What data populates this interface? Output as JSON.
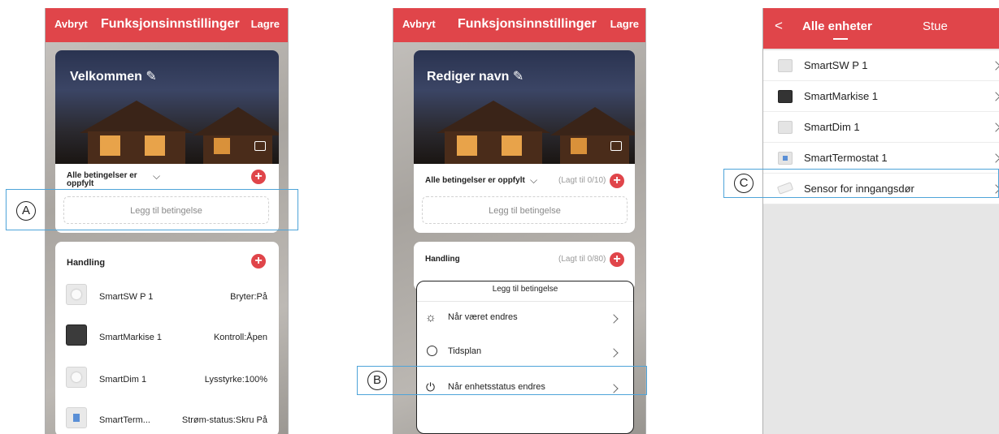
{
  "panel1": {
    "header": {
      "cancel": "Avbryt",
      "title": "Funksjonsinnstillinger",
      "save": "Lagre"
    },
    "scene_name": "Velkommen",
    "conditions": {
      "label": "Alle betingelser er oppfylt",
      "add_condition": "Legg til betingelse"
    },
    "action": {
      "title": "Handling",
      "items": [
        {
          "name": "SmartSW P 1",
          "status": "Bryter:På"
        },
        {
          "name": "SmartMarkise 1",
          "status": "Kontroll:Åpen"
        },
        {
          "name": "SmartDim 1",
          "status": "Lysstyrke:100%"
        },
        {
          "name": "SmartTerm...",
          "status": "Strøm-status:Skru På"
        }
      ]
    }
  },
  "panel2": {
    "header": {
      "cancel": "Avbryt",
      "title": "Funksjonsinnstillinger",
      "save": "Lagre"
    },
    "scene_name": "Rediger navn",
    "conditions": {
      "label": "Alle betingelser er oppfylt",
      "count": "(Lagt til 0/10)",
      "add_condition": "Legg til betingelse"
    },
    "action": {
      "title": "Handling",
      "count": "(Lagt til 0/80)"
    },
    "sheet": {
      "title": "Legg til betingelse",
      "options": [
        {
          "icon": "weather-icon",
          "label": "Når været endres"
        },
        {
          "icon": "clock-icon",
          "label": "Tidsplan"
        },
        {
          "icon": "power-icon",
          "label": "Når enhetsstatus endres"
        }
      ]
    }
  },
  "panel3": {
    "header": {
      "tab_all": "Alle enheter",
      "tab_room": "Stue"
    },
    "devices": [
      {
        "name": "SmartSW P 1"
      },
      {
        "name": "SmartMarkise 1"
      },
      {
        "name": "SmartDim 1"
      },
      {
        "name": "SmartTermostat 1"
      },
      {
        "name": "Sensor for inngangsdør"
      }
    ]
  },
  "callouts": {
    "a": "A",
    "b": "B",
    "c": "C"
  },
  "colors": {
    "accent": "#e0454a",
    "callout": "#4ea4d9"
  }
}
